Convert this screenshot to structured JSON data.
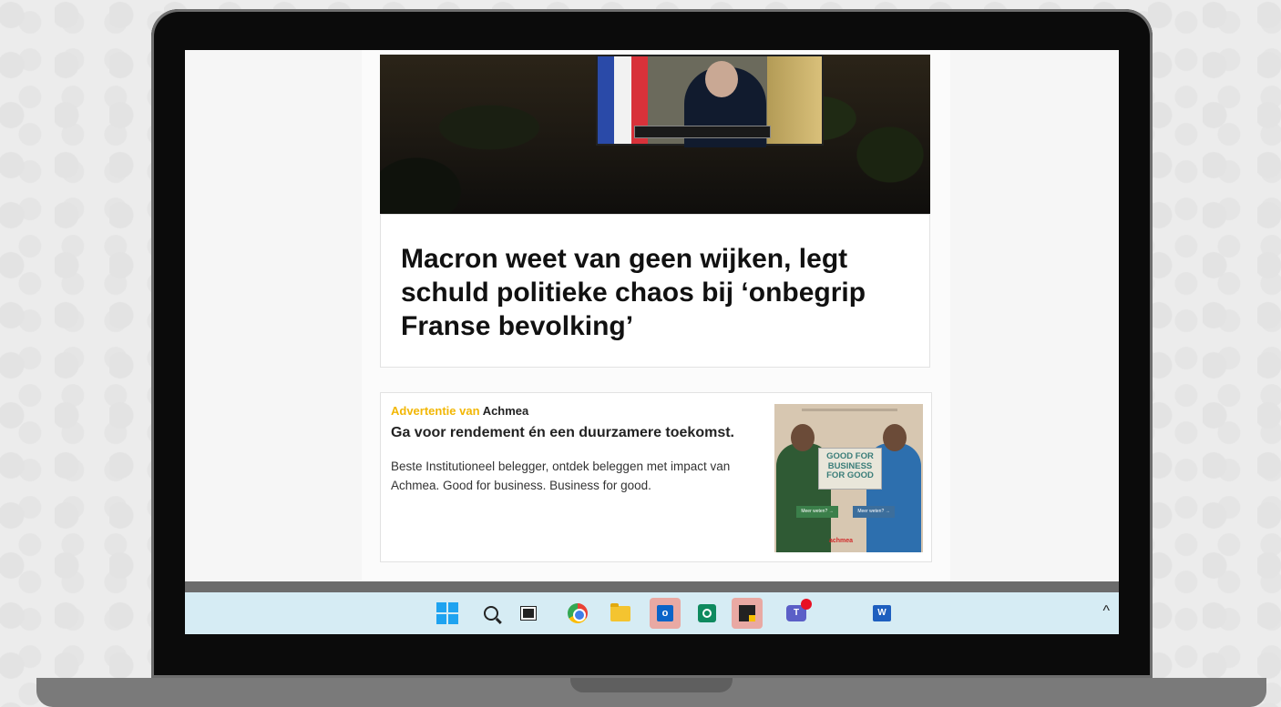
{
  "article": {
    "headline": "Macron weet van geen wijken, legt schuld politieke chaos bij ‘onbegrip Franse bevolking’"
  },
  "ad": {
    "label_prefix": "Advertentie van",
    "advertiser": "Achmea",
    "title": "Ga voor rendement én een duurzamere toekomst.",
    "body": "Beste Institutioneel belegger, ontdek beleggen met impact van Achmea. Good for business. Business for good.",
    "image_text": "GOOD FOR BUSINESS FOR GOOD",
    "image_button_left": "Meer weten? →",
    "image_button_right": "Meer weten? →",
    "image_logo": "achmea",
    "colors": {
      "label_prefix": "#f2b705"
    }
  },
  "taskbar": {
    "icons": [
      "windows-start-icon",
      "search-icon",
      "task-view-icon",
      "chrome-icon",
      "file-explorer-icon",
      "outlook-icon",
      "green-app-icon",
      "sticky-notes-icon",
      "teams-icon",
      "word-icon"
    ],
    "highlighted": [
      "outlook-icon",
      "sticky-notes-icon"
    ],
    "outlook_glyph": "o",
    "teams_glyph": "T",
    "word_glyph": "W",
    "tray_chevron": "^"
  }
}
